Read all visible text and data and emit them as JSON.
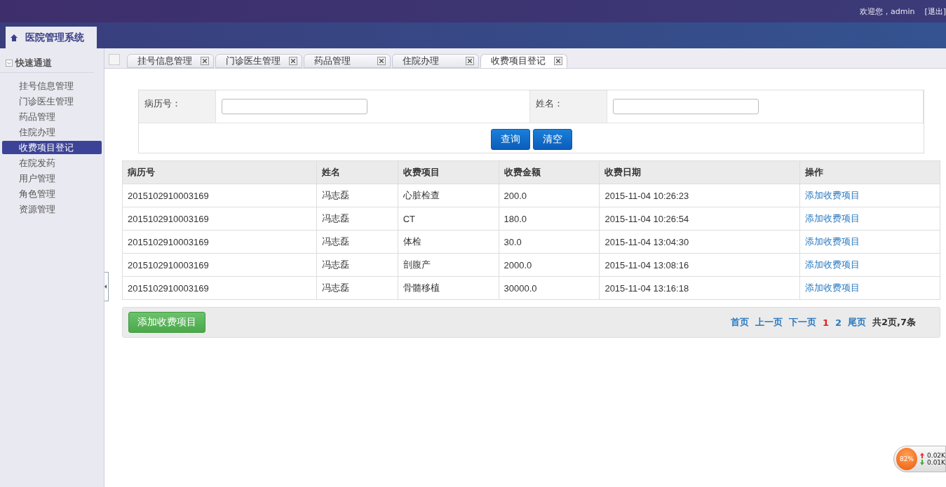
{
  "header": {
    "welcome": "欢迎您，admin",
    "logout": "[退出]"
  },
  "app_title": "医院管理系统",
  "sidebar": {
    "title": "快速通道",
    "expanded": true,
    "items": [
      {
        "label": "挂号信息管理",
        "selected": false
      },
      {
        "label": "门诊医生管理",
        "selected": false
      },
      {
        "label": "药品管理",
        "selected": false
      },
      {
        "label": "住院办理",
        "selected": false
      },
      {
        "label": "收费项目登记",
        "selected": true
      },
      {
        "label": "在院发药",
        "selected": false
      },
      {
        "label": "用户管理",
        "selected": false
      },
      {
        "label": "角色管理",
        "selected": false
      },
      {
        "label": "资源管理",
        "selected": false
      }
    ]
  },
  "tabs": [
    {
      "label": "挂号信息管理",
      "selected": false
    },
    {
      "label": "门诊医生管理",
      "selected": false
    },
    {
      "label": "药品管理",
      "selected": false
    },
    {
      "label": "住院办理",
      "selected": false
    },
    {
      "label": "收费项目登记",
      "selected": true
    }
  ],
  "search": {
    "fields": [
      {
        "label": "病历号："
      },
      {
        "label": "姓名："
      }
    ],
    "buttons": [
      "查询",
      "清空"
    ]
  },
  "table": {
    "columns": [
      "病历号",
      "姓名",
      "收费项目",
      "收费金额",
      "收费日期",
      "操作"
    ],
    "rows": [
      [
        "2015102910003169",
        "冯志磊",
        "心脏检查",
        "200.0",
        "2015-11-04 10:26:23",
        "添加收费项目"
      ],
      [
        "2015102910003169",
        "冯志磊",
        "CT",
        "180.0",
        "2015-11-04 10:26:54",
        "添加收费项目"
      ],
      [
        "2015102910003169",
        "冯志磊",
        "体检",
        "30.0",
        "2015-11-04 13:04:30",
        "添加收费项目"
      ],
      [
        "2015102910003169",
        "冯志磊",
        "剖腹产",
        "2000.0",
        "2015-11-04 13:08:16",
        "添加收费项目"
      ],
      [
        "2015102910003169",
        "冯志磊",
        "骨髓移植",
        "30000.0",
        "2015-11-04 13:16:18",
        "添加收费项目"
      ]
    ]
  },
  "footer": {
    "add_button": "添加收费项目",
    "pager": [
      {
        "label": "首页",
        "kind": "nav"
      },
      {
        "label": "上一页",
        "kind": "nav"
      },
      {
        "label": "下一页",
        "kind": "nav"
      },
      {
        "label": "1",
        "kind": "page",
        "selected": true
      },
      {
        "label": "2",
        "kind": "page",
        "selected": false
      },
      {
        "label": "尾页",
        "kind": "nav"
      }
    ],
    "summary": "共2页,7条"
  },
  "speed_widget": {
    "percent": "82%",
    "upload": "0.02K",
    "download": "0.01K"
  }
}
